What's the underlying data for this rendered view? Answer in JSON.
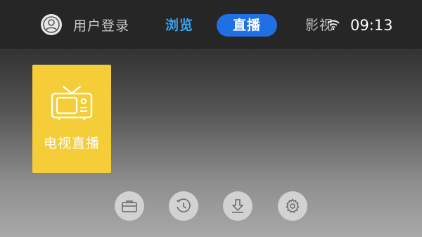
{
  "header": {
    "user_login_label": "用户登录",
    "tabs": [
      {
        "label": "浏览",
        "state": "highlighted"
      },
      {
        "label": "直播",
        "state": "selected"
      },
      {
        "label": "影视",
        "state": "normal"
      }
    ],
    "time": "09:13",
    "icons": {
      "avatar": "user-avatar-icon",
      "wifi": "wifi-icon"
    }
  },
  "main": {
    "tiles": [
      {
        "label": "电视直播",
        "icon": "tv-icon",
        "color": "#f4cd39"
      }
    ]
  },
  "dock": {
    "buttons": [
      {
        "icon": "folder-icon"
      },
      {
        "icon": "history-clock-icon"
      },
      {
        "icon": "download-icon"
      },
      {
        "icon": "settings-gear-icon"
      }
    ]
  },
  "colors": {
    "accent": "#1f6fe5",
    "highlight": "#3aa5f2",
    "tile": "#f4cd39"
  }
}
